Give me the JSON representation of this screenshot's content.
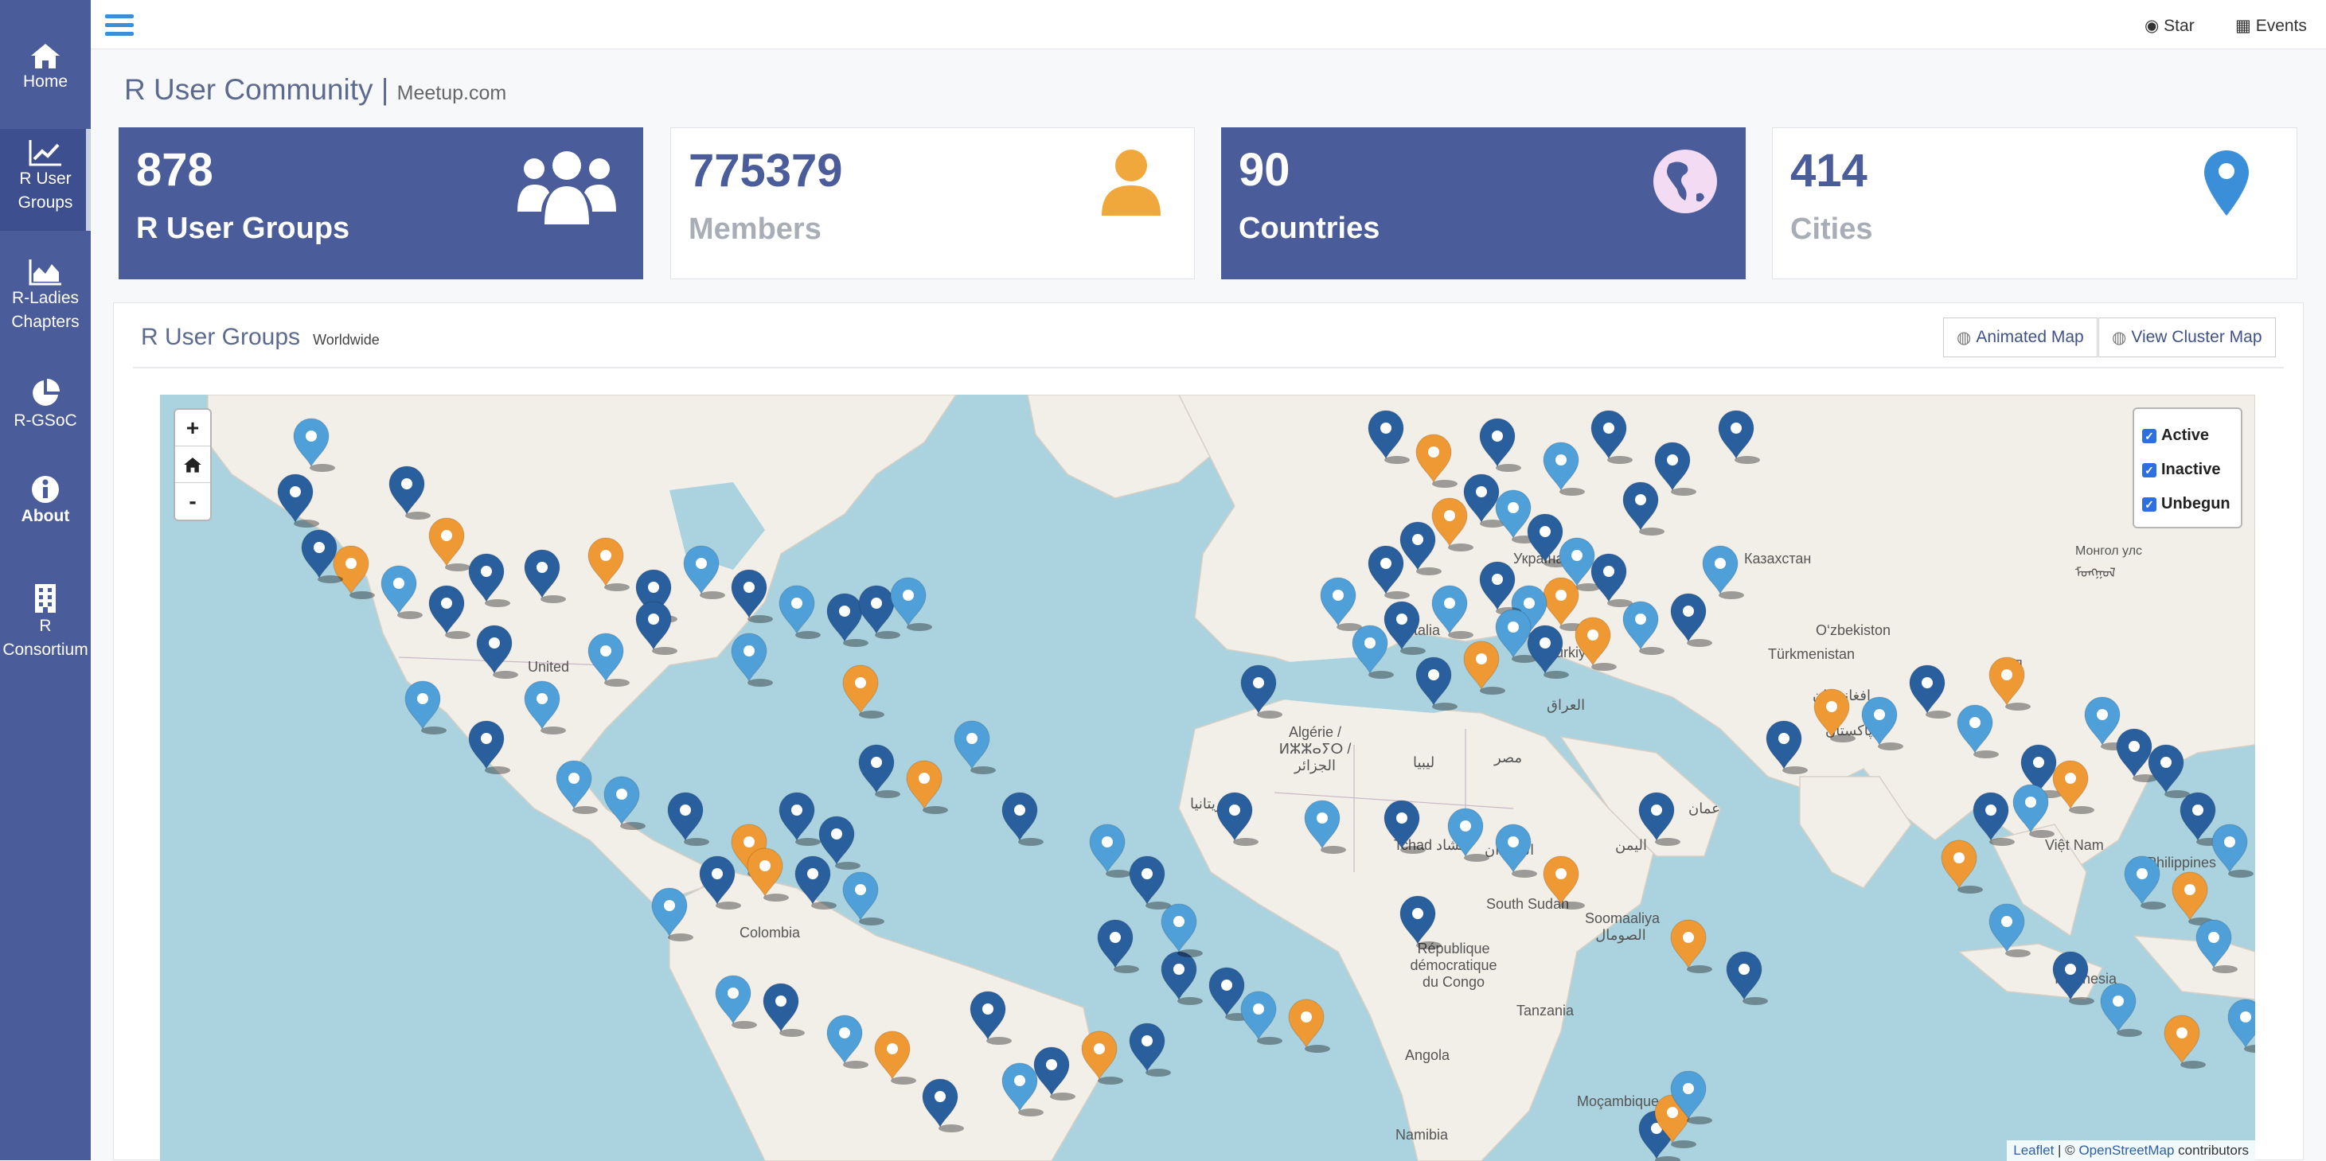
{
  "sidebar": {
    "items": [
      {
        "label": "Home"
      },
      {
        "label": "R User Groups"
      },
      {
        "label": "R-Ladies Chapters"
      },
      {
        "label": "R-GSoC"
      },
      {
        "label": "About"
      },
      {
        "label": "R Consortium"
      }
    ]
  },
  "topbar": {
    "star_label": "Star",
    "events_label": "Events"
  },
  "page": {
    "title": "R User Community |",
    "subtitle": "Meetup.com"
  },
  "stats": [
    {
      "value": "878",
      "label": "R User Groups"
    },
    {
      "value": "775379",
      "label": "Members"
    },
    {
      "value": "90",
      "label": "Countries"
    },
    {
      "value": "414",
      "label": "Cities"
    }
  ],
  "panel": {
    "title": "R User Groups",
    "subtitle": "Worldwide",
    "animated_map_label": "Animated Map",
    "cluster_map_label": "View Cluster Map"
  },
  "map": {
    "zoom_in": "+",
    "zoom_out": "-",
    "layers": [
      "Active",
      "Inactive",
      "Unbegun"
    ],
    "attribution": {
      "leaflet": "Leaflet",
      "sep": " | © ",
      "osm": "OpenStreetMap",
      "suffix": " contributors"
    },
    "labels": [
      "United",
      "Україна",
      "Казахстан",
      "Монгол улс ᠮᠣᠩᠭᠣᠯ",
      "Italia",
      "Türkiye",
      "O‘zbekiston",
      "Türkmenistan",
      "افغانستان",
      "پاکستان",
      "中国",
      "العراق",
      "Algérie / ⵍⵣⵣⴰⵢⵔ / الجزائر",
      "ليبيا",
      "مصر",
      "موريتانيا",
      "Tchad تشاد",
      "السودان",
      "اليمن",
      "عمان",
      "South Sudan",
      "Soomaaliya الصومال",
      "République démocratique du Congo",
      "Tanzania",
      "Angola",
      "Namibia",
      "Moçambique",
      "Indonesia",
      "Việt Nam",
      "Philippines",
      "Colombia"
    ]
  },
  "colors": {
    "active": "#4f9fd8",
    "inactive": "#2a5f9e",
    "unbegun": "#ee9933",
    "brand": "#4a5c9a"
  }
}
